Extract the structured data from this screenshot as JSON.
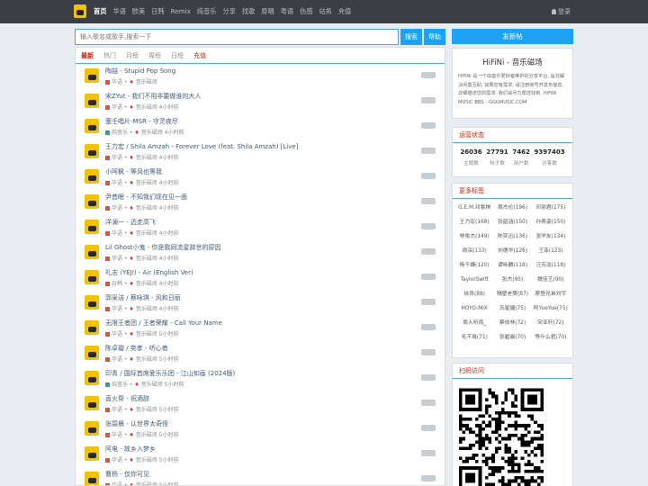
{
  "nav": {
    "items": [
      {
        "label": "首页",
        "active": true
      },
      {
        "label": "华语"
      },
      {
        "label": "欧美"
      },
      {
        "label": "日韩"
      },
      {
        "label": "Remix"
      },
      {
        "label": "纯音乐"
      },
      {
        "label": "分享"
      },
      {
        "label": "找歌"
      },
      {
        "label": "原唱"
      },
      {
        "label": "粤语"
      },
      {
        "label": "伤感"
      },
      {
        "label": "站务"
      },
      {
        "label": "充值"
      }
    ],
    "login": "登录"
  },
  "search": {
    "placeholder": "输入歌名或歌手,搜索一下",
    "search_label": "搜索",
    "help_label": "帮助"
  },
  "tabs": [
    {
      "label": "最新",
      "state": "active"
    },
    {
      "label": "热门"
    },
    {
      "label": "月榜"
    },
    {
      "label": "周榜"
    },
    {
      "label": "日榜"
    },
    {
      "label": "充值",
      "state": "red"
    }
  ],
  "threads": [
    {
      "title": "陶喆 - Stupid Pop Song",
      "cat": "华语",
      "user": "音乐磁场",
      "time": "",
      "color": "#e74c3c"
    },
    {
      "title": "宋ZYut - 我们不用非要做谁的大人",
      "cat": "华语",
      "user": "音乐磁场",
      "time": "4小时前",
      "color": "#e74c3c"
    },
    {
      "title": "塞壬唱片-MSR - 守灵夜尽",
      "cat": "纯音乐",
      "user": "音乐磁场",
      "time": "4小时前",
      "color": "#3ba07e"
    },
    {
      "title": "王力宏 / Shila Amzah - Forever Love (feat. Shila Amzah) [Live]",
      "cat": "华语",
      "user": "音乐磁场",
      "time": "4小时前",
      "color": "#e74c3c"
    },
    {
      "title": "小阿枫 - 等风也等我",
      "cat": "华语",
      "user": "音乐磁场",
      "time": "4小时前",
      "color": "#e74c3c"
    },
    {
      "title": "尹昔眠 - 不知我们现在见一面",
      "cat": "华语",
      "user": "音乐磁场",
      "time": "4小时前",
      "color": "#e74c3c"
    },
    {
      "title": "洋澜一 - 迈走高飞",
      "cat": "华语",
      "user": "音乐磁场",
      "time": "4小时前",
      "color": "#e74c3c"
    },
    {
      "title": "Lil Ghost小鬼 - 你是我同流星辞世的原因",
      "cat": "华语",
      "user": "音乐磁场",
      "time": "4小时前",
      "color": "#e74c3c"
    },
    {
      "title": "礼志 (YEJI) - Air (English Ver)",
      "cat": "日韩",
      "user": "音乐磁场",
      "time": "4小时前",
      "color": "#e74c3c"
    },
    {
      "title": "郭采洁 / 蔡咏琪 - 风和日丽",
      "cat": "华语",
      "user": "音乐磁场",
      "time": "4小时前",
      "color": "#e74c3c"
    },
    {
      "title": "无限王者团 / 王者荣耀 - Call Your Name",
      "cat": "华语",
      "user": "音乐磁场",
      "time": "5小时前",
      "color": "#e74c3c"
    },
    {
      "title": "陈卓璇 / 奕孝 - 听心者",
      "cat": "华语",
      "user": "音乐磁场",
      "time": "5小时前",
      "color": "#e74c3c"
    },
    {
      "title": "印青 / 国际首席爱乐乐团 - 江山如画 (2024版)",
      "cat": "纯音乐",
      "user": "音乐磁场",
      "time": "5小时前",
      "color": "#3ba07e"
    },
    {
      "title": "直火帮 - 祝酒辞",
      "cat": "华语",
      "user": "音乐磁场",
      "time": "5小时前",
      "color": "#e74c3c"
    },
    {
      "title": "张碧晨 - 认世界太奇怪",
      "cat": "华语",
      "user": "音乐磁场",
      "time": "5小时前",
      "color": "#e74c3c"
    },
    {
      "title": "阿电 - 故乡入梦乡",
      "cat": "华语",
      "user": "音乐磁场",
      "time": "5小时前",
      "color": "#e74c3c"
    },
    {
      "title": "曹杨 - 仅你可见",
      "cat": "华语",
      "user": "音乐磁场",
      "time": "5小时前",
      "color": "#e74c3c"
    }
  ],
  "sidebar": {
    "new_post": "发新帖",
    "site_title": "HiFiNi - 音乐磁场",
    "site_desc": "HiFiNi 是一个由音乐爱好者维护的分享平台, 旨在解决闲置互助, 如果您有需求, 请注册账号开发布信息, 详细描述您的需求. 我们会尽力帮您找到. HiFiNi MUSIC BBS - GGGMUSIC.COM",
    "stats_title": "运营状态",
    "stats": [
      {
        "value": "26036",
        "label": "主题数"
      },
      {
        "value": "27791",
        "label": "帖子数"
      },
      {
        "value": "7462",
        "label": "用户数"
      },
      {
        "value": "9397403",
        "label": "访客数"
      }
    ],
    "tags_title": "更多标签",
    "tags": [
      "G.E.M.邓紫棋",
      "周杰伦(196)",
      "邓丽君(175)",
      "王力宏(168)",
      "张韶涵(150)",
      "孙燕姿(150)",
      "林俊杰(149)",
      "陈奕迅(136)",
      "张学友(134)",
      "周深(133)",
      "刘德华(126)",
      "王菲(123)",
      "杨千嬅(120)",
      "谭咏麟(118)",
      "汪苏泷(118)",
      "TaylorSwift",
      "张杰(95)",
      "魏佳艺(90)",
      "徐良(88)",
      "隔壁老樊(87)",
      "摩登兄弟刘宇",
      "HOYO-MiX",
      "苏星婕(75)",
      "阿YueYue(75)",
      "周人听雨_",
      "蔡依林(72)",
      "宋亚轩(72)",
      "毛不易(71)",
      "张碧晨(70)",
      "等什么君(70)"
    ],
    "scan_title": "扫码访问"
  },
  "colors": {
    "accent": "#1da1f2",
    "topbar": "#3b3f45",
    "heading_red": "#d81e06",
    "link": "#3d5a80"
  }
}
